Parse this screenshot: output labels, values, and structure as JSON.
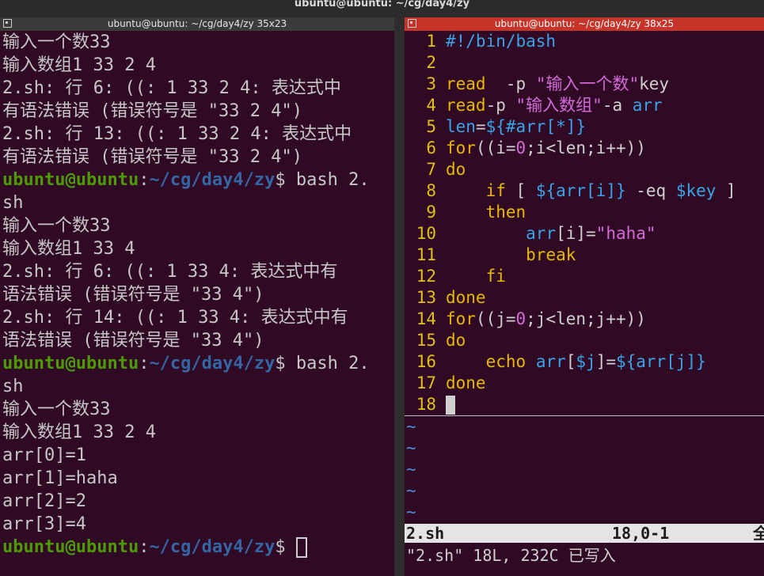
{
  "top_title": "ubuntu@ubuntu: ~/cg/day4/zy",
  "left": {
    "title": "ubuntu@ubuntu: ~/cg/day4/zy 35x23",
    "lines": [
      {
        "t": "out",
        "text": "输入一个数33"
      },
      {
        "t": "out",
        "text": "输入数组1 33 2 4"
      },
      {
        "t": "out",
        "text": "2.sh: 行 6: ((: 1 33 2 4: 表达式中"
      },
      {
        "t": "out",
        "text": "有语法错误 (错误符号是 \"33 2 4\")"
      },
      {
        "t": "out",
        "text": "2.sh: 行 13: ((: 1 33 2 4: 表达式中"
      },
      {
        "t": "out",
        "text": "有语法错误 (错误符号是 \"33 2 4\")"
      },
      {
        "t": "prompt",
        "user": "ubuntu@ubuntu",
        "colon": ":",
        "path": "~/cg/day4/zy",
        "dollar": "$",
        "cmd": " bash 2."
      },
      {
        "t": "out",
        "text": "sh"
      },
      {
        "t": "out",
        "text": "输入一个数33"
      },
      {
        "t": "out",
        "text": "输入数组1 33 4"
      },
      {
        "t": "out",
        "text": "2.sh: 行 6: ((: 1 33 4: 表达式中有"
      },
      {
        "t": "out",
        "text": "语法错误 (错误符号是 \"33 4\")"
      },
      {
        "t": "out",
        "text": "2.sh: 行 14: ((: 1 33 4: 表达式中有"
      },
      {
        "t": "out",
        "text": "语法错误 (错误符号是 \"33 4\")"
      },
      {
        "t": "prompt",
        "user": "ubuntu@ubuntu",
        "colon": ":",
        "path": "~/cg/day4/zy",
        "dollar": "$",
        "cmd": " bash 2."
      },
      {
        "t": "out",
        "text": "sh"
      },
      {
        "t": "out",
        "text": "输入一个数33"
      },
      {
        "t": "out",
        "text": "输入数组1 33 2 4"
      },
      {
        "t": "out",
        "text": "arr[0]=1"
      },
      {
        "t": "out",
        "text": "arr[1]=haha"
      },
      {
        "t": "out",
        "text": "arr[2]=2"
      },
      {
        "t": "out",
        "text": "arr[3]=4"
      },
      {
        "t": "prompt",
        "user": "ubuntu@ubuntu",
        "colon": ":",
        "path": "~/cg/day4/zy",
        "dollar": "$",
        "cmd": " ",
        "cursor": true
      }
    ]
  },
  "right": {
    "title": "ubuntu@ubuntu: ~/cg/day4/zy 38x25",
    "code": [
      {
        "n": "1",
        "seg": [
          [
            "cm",
            "#!/bin/bash"
          ]
        ]
      },
      {
        "n": "2",
        "seg": []
      },
      {
        "n": "3",
        "seg": [
          [
            "kw",
            "read"
          ],
          [
            "",
            "  "
          ],
          [
            "",
            "-p "
          ],
          [
            "st",
            "\"输入一个数\""
          ],
          [
            "",
            ""
          ],
          [
            "",
            ""
          ],
          [
            "",
            "key"
          ]
        ]
      },
      {
        "n": "4",
        "seg": [
          [
            "kw",
            "read"
          ],
          [
            "",
            ""
          ],
          [
            "",
            ""
          ],
          [
            "",
            "-p "
          ],
          [
            "st",
            "\"输入数组\""
          ],
          [
            "",
            ""
          ],
          [
            "",
            ""
          ],
          [
            "",
            "-a "
          ],
          [
            "va",
            "arr"
          ]
        ]
      },
      {
        "n": "5",
        "seg": [
          [
            "va",
            "len"
          ],
          [
            "",
            "="
          ],
          [
            "va",
            "${#arr[*]}"
          ]
        ]
      },
      {
        "n": "6",
        "seg": [
          [
            "kw",
            "for"
          ],
          [
            "",
            "((i="
          ],
          [
            "nu",
            "0"
          ],
          [
            "",
            ";i<len;i++))"
          ]
        ]
      },
      {
        "n": "7",
        "seg": [
          [
            "kw",
            "do"
          ]
        ]
      },
      {
        "n": "8",
        "seg": [
          [
            "",
            "    "
          ],
          [
            "kw",
            "if"
          ],
          [
            "",
            " [ "
          ],
          [
            "va",
            "${arr[i]}"
          ],
          [
            "",
            " -eq "
          ],
          [
            "va",
            "$key"
          ],
          [
            "",
            " ]"
          ]
        ]
      },
      {
        "n": "9",
        "seg": [
          [
            "",
            "    "
          ],
          [
            "kw",
            "then"
          ]
        ]
      },
      {
        "n": "10",
        "seg": [
          [
            "",
            "        "
          ],
          [
            "va",
            "arr"
          ],
          [
            "",
            "[i]="
          ],
          [
            "st",
            "\"haha\""
          ]
        ]
      },
      {
        "n": "11",
        "seg": [
          [
            "",
            "        "
          ],
          [
            "kw",
            "break"
          ]
        ]
      },
      {
        "n": "12",
        "seg": [
          [
            "",
            "    "
          ],
          [
            "kw",
            "fi"
          ]
        ]
      },
      {
        "n": "13",
        "seg": [
          [
            "kw",
            "done"
          ]
        ]
      },
      {
        "n": "14",
        "seg": [
          [
            "kw",
            "for"
          ],
          [
            "",
            "((j="
          ],
          [
            "nu",
            "0"
          ],
          [
            "",
            ";j<len;j++))"
          ]
        ]
      },
      {
        "n": "15",
        "seg": [
          [
            "kw",
            "do"
          ]
        ]
      },
      {
        "n": "16",
        "seg": [
          [
            "",
            "    "
          ],
          [
            "kw",
            "echo"
          ],
          [
            "",
            " "
          ],
          [
            "va",
            "arr"
          ],
          [
            "",
            "["
          ],
          [
            "va",
            "$j"
          ],
          [
            "",
            "]="
          ],
          [
            "va",
            "${arr[j]}"
          ]
        ]
      },
      {
        "n": "17",
        "seg": [
          [
            "kw",
            "done"
          ]
        ]
      },
      {
        "n": "18",
        "seg": [],
        "cursor": true
      }
    ],
    "tildes": [
      "~",
      "~",
      "~",
      "~",
      "~"
    ],
    "status_file": "2.sh",
    "status_pos": "18,0-1",
    "status_pct": "全",
    "message": "\"2.sh\" 18L, 232C 已写入"
  }
}
